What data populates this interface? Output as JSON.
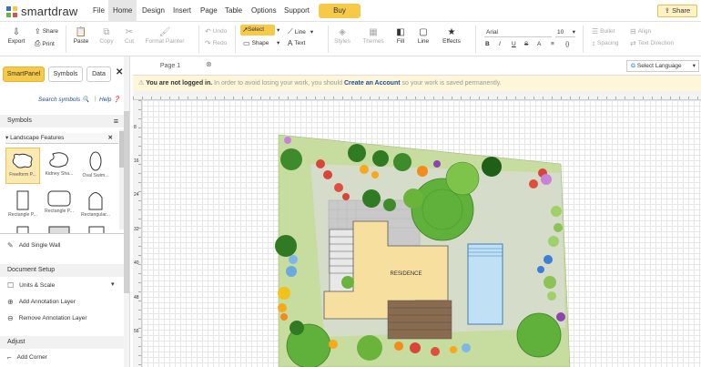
{
  "app": {
    "logo_text": "smartdraw"
  },
  "menu": [
    "File",
    "Home",
    "Design",
    "Insert",
    "Page",
    "Table",
    "Options",
    "Support"
  ],
  "menu_active": "Home",
  "buy_label": "Buy",
  "share_top_label": "Share",
  "ribbon": {
    "export": "Export",
    "share": "Share",
    "print": "Print",
    "paste": "Paste",
    "copy": "Copy",
    "cut": "Cut",
    "format_painter": "Format Painter",
    "undo": "Undo",
    "redo": "Redo",
    "select": "Select",
    "shape": "Shape",
    "line_tool": "Line",
    "text": "Text",
    "styles": "Styles",
    "themes": "Themes",
    "fill": "Fill",
    "line": "Line",
    "effects": "Effects",
    "font": "Arial",
    "font_size": "10",
    "bold": "B",
    "italic": "I",
    "underline": "U",
    "strike": "S",
    "text_a": "A",
    "align_c": "≡",
    "braces": "{}",
    "bullet": "Bullet",
    "spacing": "Spacing",
    "align": "Align",
    "text_direction": "Text Direction"
  },
  "left_panel": {
    "tabs": [
      "SmartPanel",
      "Symbols",
      "Data"
    ],
    "search_symbols": "Search symbols",
    "help": "Help",
    "symbols_header": "Symbols",
    "library": "Landscape Features",
    "symbols": [
      {
        "label": "Freeform P..."
      },
      {
        "label": "Kidney Sha..."
      },
      {
        "label": "Oval Swim..."
      },
      {
        "label": "Rectangle P..."
      },
      {
        "label": "Rectangle P..."
      },
      {
        "label": "Rectangular..."
      }
    ],
    "add_single_wall": "Add Single Wall",
    "document_setup": "Document Setup",
    "units_scale": "Units & Scale",
    "add_annotation": "Add Annotation Layer",
    "remove_annotation": "Remove Annotation Layer",
    "adjust": "Adjust",
    "add_corner": "Add Corner"
  },
  "page_tab": "Page 1",
  "select_language": "Select Language",
  "notice": {
    "bold": "You are not logged in.",
    "text1": " In order to avoid losing your work, you should ",
    "link": "Create an Account",
    "text2": " so your work is saved permanently."
  },
  "ruler_numbers": [
    "8",
    "16",
    "24",
    "32",
    "40",
    "48",
    "56"
  ],
  "plan": {
    "residence_label": "RESIDENCE"
  },
  "colors": {
    "accent": "#f7c948",
    "link": "#1a4f9c",
    "lawn": "#c7dc9f",
    "pool": "#bfe0f5"
  }
}
